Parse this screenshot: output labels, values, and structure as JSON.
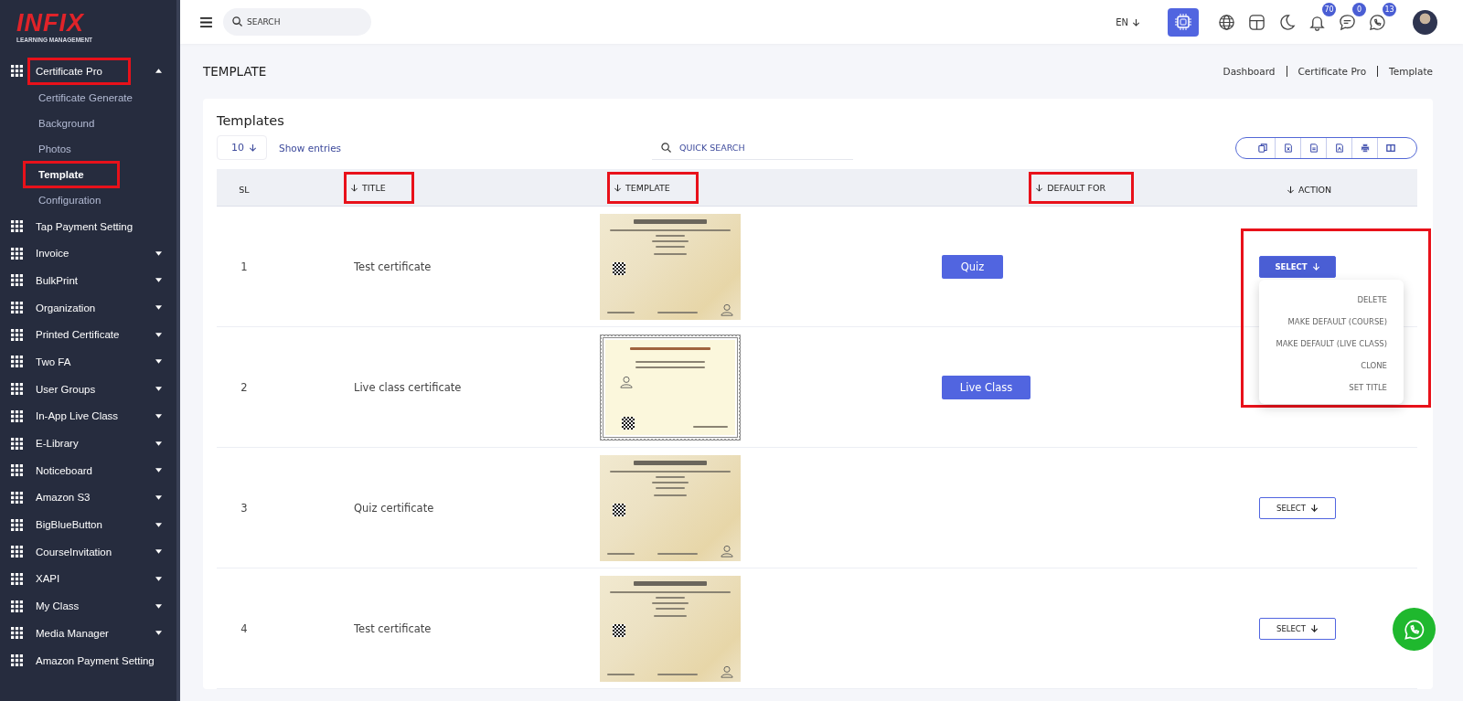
{
  "logo": {
    "brand": "INFIX",
    "tagline": "LEARNING MANAGEMENT"
  },
  "sidebar": {
    "items": [
      {
        "label": "Certificate Pro",
        "kind": "group",
        "expanded": true,
        "highlighted": true,
        "children": [
          {
            "label": "Certificate Generate",
            "selected": false,
            "highlighted": false
          },
          {
            "label": "Background",
            "selected": false,
            "highlighted": false
          },
          {
            "label": "Photos",
            "selected": false,
            "highlighted": false
          },
          {
            "label": "Template",
            "selected": true,
            "highlighted": true
          },
          {
            "label": "Configuration",
            "selected": false,
            "highlighted": false
          }
        ]
      },
      {
        "label": "Tap Payment Setting",
        "kind": "link",
        "highlighted": false
      },
      {
        "label": "Invoice",
        "kind": "group",
        "expanded": false,
        "highlighted": false
      },
      {
        "label": "BulkPrint",
        "kind": "group",
        "expanded": false,
        "highlighted": false
      },
      {
        "label": "Organization",
        "kind": "group",
        "expanded": false,
        "highlighted": false
      },
      {
        "label": "Printed Certificate",
        "kind": "group",
        "expanded": false,
        "highlighted": false
      },
      {
        "label": "Two FA",
        "kind": "group",
        "expanded": false,
        "highlighted": false
      },
      {
        "label": "User Groups",
        "kind": "group",
        "expanded": false,
        "highlighted": false
      },
      {
        "label": "In-App Live Class",
        "kind": "group",
        "expanded": false,
        "highlighted": false
      },
      {
        "label": "E-Library",
        "kind": "group",
        "expanded": false,
        "highlighted": false
      },
      {
        "label": "Noticeboard",
        "kind": "group",
        "expanded": false,
        "highlighted": false
      },
      {
        "label": "Amazon S3",
        "kind": "group",
        "expanded": false,
        "highlighted": false
      },
      {
        "label": "BigBlueButton",
        "kind": "group",
        "expanded": false,
        "highlighted": false
      },
      {
        "label": "CourseInvitation",
        "kind": "group",
        "expanded": false,
        "highlighted": false
      },
      {
        "label": "XAPI",
        "kind": "group",
        "expanded": false,
        "highlighted": false
      },
      {
        "label": "My Class",
        "kind": "group",
        "expanded": false,
        "highlighted": false
      },
      {
        "label": "Media Manager",
        "kind": "group",
        "expanded": false,
        "highlighted": false
      },
      {
        "label": "Amazon Payment Setting",
        "kind": "link",
        "highlighted": false
      }
    ]
  },
  "topbar": {
    "search": {
      "placeholder": "SEARCH"
    },
    "language": "EN",
    "badges": {
      "notifications": "70",
      "messages": "0",
      "whatsapp": "13"
    }
  },
  "page": {
    "title": "TEMPLATE",
    "breadcrumbs": [
      "Dashboard",
      "Certificate Pro",
      "Template"
    ]
  },
  "card": {
    "title": "Templates",
    "entries": "10",
    "entries_label": "Show entries",
    "quick_search": {
      "placeholder": "QUICK SEARCH"
    }
  },
  "table": {
    "columns": [
      {
        "label": "SL",
        "sortable": false,
        "highlighted": false
      },
      {
        "label": "TITLE",
        "sortable": true,
        "highlighted": true
      },
      {
        "label": "TEMPLATE",
        "sortable": true,
        "highlighted": true
      },
      {
        "label": "DEFAULT FOR",
        "sortable": true,
        "highlighted": true
      },
      {
        "label": "ACTION",
        "sortable": true,
        "highlighted": false
      }
    ],
    "rows": [
      {
        "sl": "1",
        "title": "Test certificate",
        "default_for": "Quiz",
        "action": {
          "label": "SELECT",
          "open": true,
          "highlighted": true
        },
        "preview": {
          "kind": "quiz"
        }
      },
      {
        "sl": "2",
        "title": "Live class certificate",
        "default_for": "Live Class",
        "preview": {
          "kind": "live"
        }
      },
      {
        "sl": "3",
        "title": "Quiz certificate",
        "action": {
          "label": "SELECT",
          "open": false
        },
        "preview": {
          "kind": "quiz"
        }
      },
      {
        "sl": "4",
        "title": "Test certificate",
        "action": {
          "label": "SELECT",
          "open": false
        },
        "preview": {
          "kind": "quiz"
        }
      }
    ]
  },
  "action_menu": [
    "DELETE",
    "MAKE DEFAULT (COURSE)",
    "MAKE DEFAULT (LIVE CLASS)",
    "CLONE",
    "SET TITLE"
  ]
}
